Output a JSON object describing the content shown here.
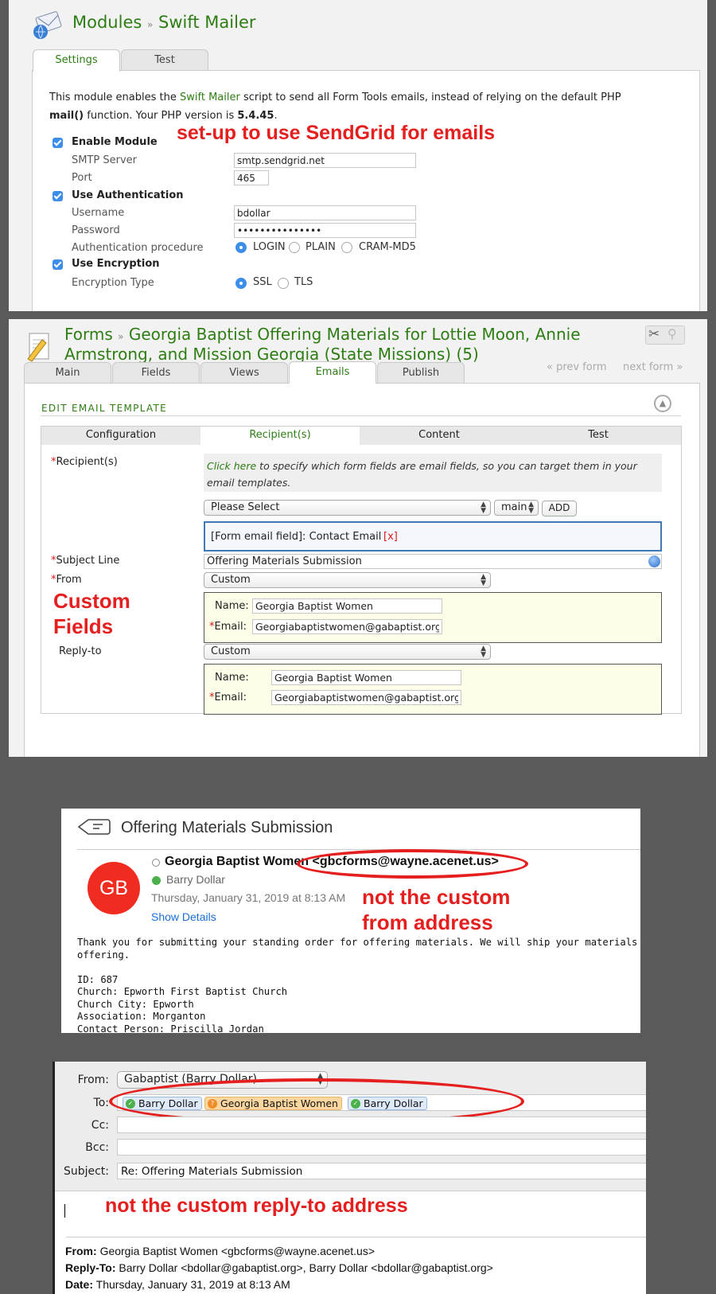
{
  "swift": {
    "breadcrumb_root": "Modules",
    "breadcrumb_sep": "»",
    "breadcrumb_page": "Swift Mailer",
    "tabs": [
      "Settings",
      "Test"
    ],
    "desc_pre": "This module enables the ",
    "desc_link": "Swift Mailer",
    "desc_mid": " script to send all Form Tools emails, instead of relying on the default PHP ",
    "desc_fn": "mail()",
    "desc_post": " function. Your PHP version is ",
    "php_version": "5.4.45",
    "desc_end": ".",
    "enable_module": "Enable Module",
    "smtp_server_label": "SMTP Server",
    "smtp_server": "smtp.sendgrid.net",
    "port_label": "Port",
    "port": "465",
    "use_auth": "Use Authentication",
    "username_label": "Username",
    "username": "bdollar",
    "password_label": "Password",
    "password": "•••••••••••••••",
    "auth_proc_label": "Authentication procedure",
    "auth_options": [
      "LOGIN",
      "PLAIN",
      "CRAM-MD5"
    ],
    "use_encryption": "Use Encryption",
    "enc_type_label": "Encryption Type",
    "enc_options": [
      "SSL",
      "TLS"
    ],
    "annotation": "set-up to use SendGrid for emails"
  },
  "form": {
    "breadcrumb_root": "Forms",
    "breadcrumb_sep": "»",
    "title_line1": "Georgia Baptist Offering Materials for Lottie Moon, Annie",
    "title_line2": "Armstrong, and Mission Georgia (State Missions) (5)",
    "tabs": [
      "Main",
      "Fields",
      "Views",
      "Emails",
      "Publish"
    ],
    "prev_form": "« prev form",
    "next_form": "next form »",
    "section_title": "EDIT EMAIL TEMPLATE",
    "subtabs": [
      "Configuration",
      "Recipient(s)",
      "Content",
      "Test"
    ],
    "recipients_label": "Recipient(s)",
    "info_link": "Click here",
    "info_text": " to specify which form fields are email fields, so you can target them in your email templates.",
    "please_select": "Please Select",
    "main_option": "main",
    "add_button": "ADD",
    "recipient_entry": "[Form email field]: Contact Email",
    "remove": "[x]",
    "subject_label": "Subject Line",
    "subject_value": "Offering Materials Submission",
    "from_label": "From",
    "from_select": "Custom",
    "from_name_label": "Name:",
    "from_name": "Georgia Baptist Women",
    "from_email_label": "Email:",
    "from_email": "Georgiabaptistwomen@gabaptist.org",
    "replyto_label": "Reply-to",
    "replyto_select": "Custom",
    "reply_name_label": "Name:",
    "reply_name": "Georgia Baptist Women",
    "reply_email_label": "Email:",
    "reply_email": "Georgiabaptistwomen@gabaptist.org",
    "annotation_line1": "Custom",
    "annotation_line2": "Fields"
  },
  "mail": {
    "subject": "Offering Materials Submission",
    "avatar": "GB",
    "sender_name": "Georgia Baptist Women",
    "sender_email": "<gbcforms@wayne.acenet.us>",
    "recipient": "Barry Dollar",
    "date": "Thursday, January 31, 2019 at 8:13 AM",
    "show_details": "Show Details",
    "body": "Thank you for submitting your standing order for offering materials. We will ship your materials\noffering.\n\nID: 687\nChurch: Epworth First Baptist Church\nChurch City: Epworth\nAssociation: Morganton\nContact Person: Priscilla Jordan",
    "annotation_line1": "not the custom",
    "annotation_line2": "from address"
  },
  "reply": {
    "from_label": "From:",
    "from_value": "Gabaptist (Barry Dollar)",
    "to_label": "To:",
    "to_chips": [
      "Barry Dollar",
      "Georgia Baptist Women",
      "Barry Dollar"
    ],
    "cc_label": "Cc:",
    "bcc_label": "Bcc:",
    "subject_label": "Subject:",
    "subject_value": "Re: Offering Materials Submission",
    "annotation": "not the custom reply-to address",
    "q_from_label": "From:",
    "q_from": "Georgia Baptist Women <gbcforms@wayne.acenet.us>",
    "q_reply_label": "Reply-To:",
    "q_reply": "Barry Dollar <bdollar@gabaptist.org>, Barry Dollar <bdollar@gabaptist.org>",
    "q_date_label": "Date:",
    "q_date": "Thursday, January 31, 2019 at 8:13 AM"
  },
  "colors": {
    "accent_green": "#2e7d14",
    "annotation_red": "#e51e1e",
    "checkbox_blue": "#3d8ee8"
  }
}
